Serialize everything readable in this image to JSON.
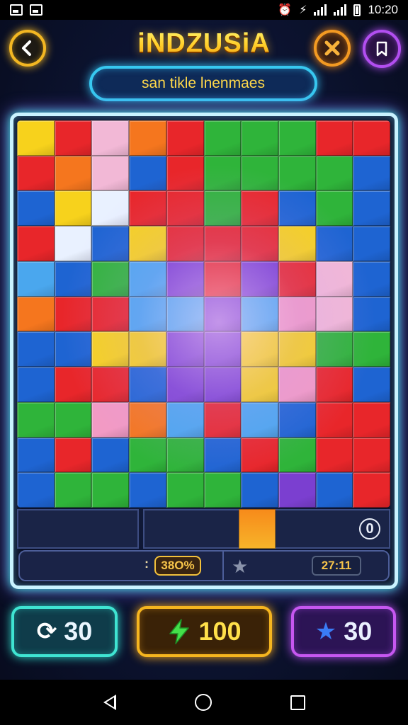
{
  "status_bar": {
    "time": "10:20"
  },
  "header": {
    "title": "iNDZUSiA",
    "subtitle": "san tikle lnenmaes"
  },
  "board": {
    "piece_colors": {
      "R": "#e8262a",
      "G": "#2fb43a",
      "B": "#1e64d2",
      "Y": "#f7d21c",
      "O": "#f5761e",
      "P": "#f29ac4",
      "W": "#e9f1ff",
      "L": "#4aa7ee",
      "V": "#7b3fd0",
      "K": "#f2b8d6"
    },
    "rows": [
      "YRKORGGGRR",
      "ROKBRGGGGB",
      "BYWRRGRBGB",
      "RWBYRRRYBB",
      "LBGLVRVRKB",
      "ORRLLVLPKB",
      "BBYYVVYYGG",
      "BRRBVVYPRB",
      "GGPOLRLBRR",
      "BRBGGBRGRR",
      "BGGBGGBVBR"
    ],
    "tray_count": "0"
  },
  "info_bar": {
    "progress_prefix": ":",
    "progress": "38O%",
    "timer": "27:11"
  },
  "bottom_buttons": {
    "reset_value": "30",
    "energy_value": "100",
    "star_value": "30"
  },
  "icons": {
    "back": "chevron-left-icon",
    "close": "close-x-icon",
    "book": "bookmark-icon",
    "reset": "refresh-icon",
    "energy": "lightning-bolt-icon",
    "star": "star-icon"
  }
}
